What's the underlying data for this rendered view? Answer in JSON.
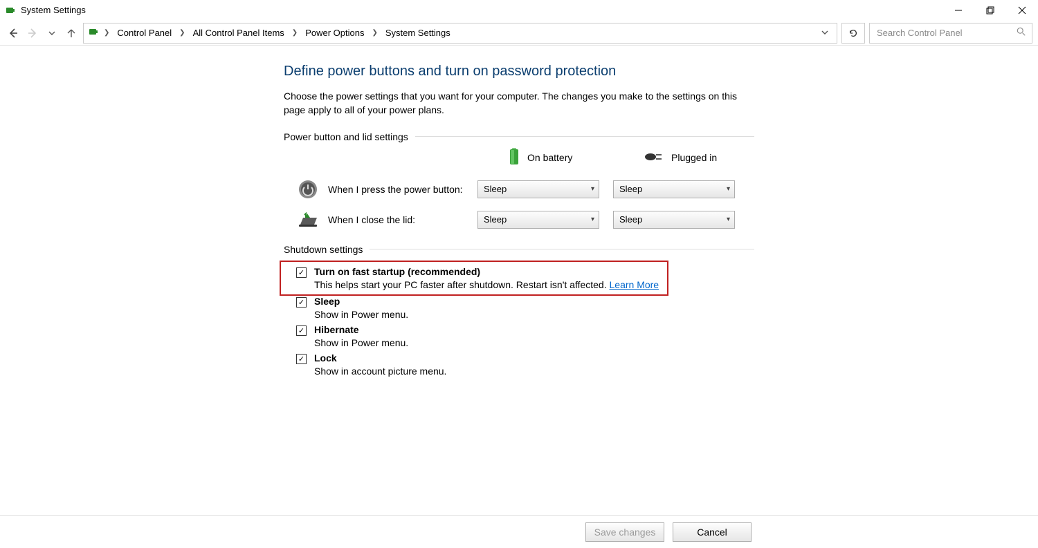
{
  "window": {
    "title": "System Settings"
  },
  "breadcrumb": {
    "items": [
      "Control Panel",
      "All Control Panel Items",
      "Power Options",
      "System Settings"
    ]
  },
  "search": {
    "placeholder": "Search Control Panel"
  },
  "main": {
    "heading": "Define power buttons and turn on password protection",
    "description": "Choose the power settings that you want for your computer. The changes you make to the settings on this page apply to all of your power plans.",
    "section_power_lid": {
      "title": "Power button and lid settings",
      "col_battery": "On battery",
      "col_plugged": "Plugged in",
      "row_power_button": "When I press the power button:",
      "row_close_lid": "When I close the lid:",
      "power_button_battery": "Sleep",
      "power_button_plugged": "Sleep",
      "close_lid_battery": "Sleep",
      "close_lid_plugged": "Sleep"
    },
    "section_shutdown": {
      "title": "Shutdown settings",
      "items": [
        {
          "checked": true,
          "label": "Turn on fast startup (recommended)",
          "desc": "This helps start your PC faster after shutdown. Restart isn't affected. ",
          "link": "Learn More",
          "highlighted": true
        },
        {
          "checked": true,
          "label": "Sleep",
          "desc": "Show in Power menu."
        },
        {
          "checked": true,
          "label": "Hibernate",
          "desc": "Show in Power menu."
        },
        {
          "checked": true,
          "label": "Lock",
          "desc": "Show in account picture menu."
        }
      ]
    }
  },
  "footer": {
    "save": "Save changes",
    "cancel": "Cancel"
  }
}
